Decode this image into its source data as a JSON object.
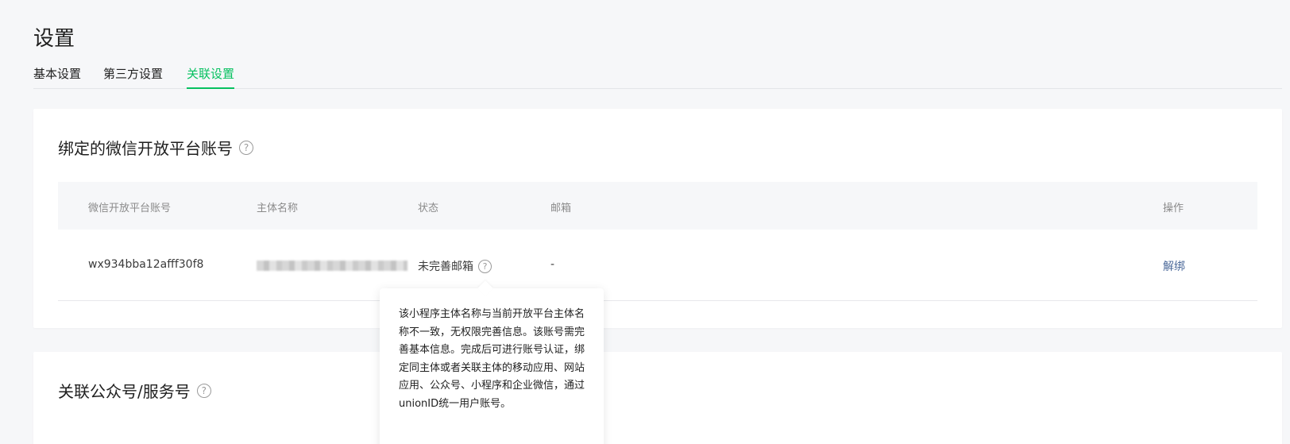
{
  "page": {
    "title": "设置"
  },
  "tabs": [
    {
      "label": "基本设置",
      "active": false
    },
    {
      "label": "第三方设置",
      "active": false
    },
    {
      "label": "关联设置",
      "active": true
    }
  ],
  "open_platform": {
    "title": "绑定的微信开放平台账号",
    "help": "?",
    "columns": [
      "微信开放平台账号",
      "主体名称",
      "状态",
      "邮箱",
      "操作"
    ],
    "rows": [
      {
        "account": "wx934bba12afff30f8",
        "status": "未完善邮箱",
        "email": "-",
        "action": "解绑"
      }
    ]
  },
  "tooltip": {
    "text": "该小程序主体名称与当前开放平台主体名称不一致，无权限完善信息。该账号需完善基本信息。完成后可进行账号认证，绑定同主体或者关联主体的移动应用、网站应用、公众号、小程序和企业微信，通过unionID统一用户账号。"
  },
  "official_account": {
    "title": "关联公众号/服务号",
    "help": "?"
  },
  "colors": {
    "accent": "#07c160",
    "link": "#4c6a9a",
    "background": "#f6f7f9"
  }
}
